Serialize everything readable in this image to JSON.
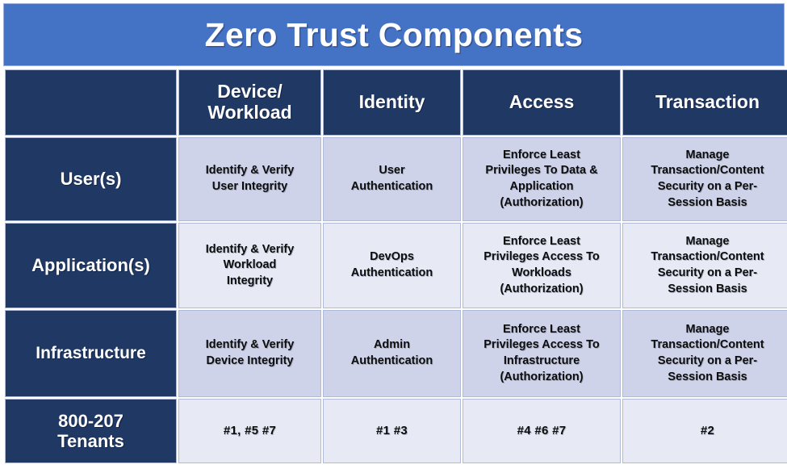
{
  "title": "Zero Trust Components",
  "colors": {
    "title_bg": "#4472C4",
    "header_bg": "#1F3864",
    "band_a": "#CED3E9",
    "band_b": "#E7EAF5",
    "header_text": "#FFFFFF",
    "cell_text": "#0D0D0D"
  },
  "table": {
    "corner_label": "",
    "columns": [
      {
        "label": "Device/\nWorkload"
      },
      {
        "label": "Identity"
      },
      {
        "label": "Access"
      },
      {
        "label": "Transaction"
      }
    ],
    "rows": [
      {
        "label": "User(s)",
        "cells": [
          "Identify & Verify\nUser Integrity",
          "User\nAuthentication",
          "Enforce Least\nPrivileges To Data &\nApplication\n(Authorization)",
          "Manage\nTransaction/Content\nSecurity on a Per-\nSession Basis"
        ]
      },
      {
        "label": "Application(s)",
        "cells": [
          "Identify & Verify\nWorkload\nIntegrity",
          "DevOps\nAuthentication",
          "Enforce Least\nPrivileges Access To\nWorkloads\n(Authorization)",
          "Manage\nTransaction/Content\nSecurity on a Per-\nSession Basis"
        ]
      },
      {
        "label": "Infrastructure",
        "cells": [
          "Identify & Verify\nDevice Integrity",
          "Admin\nAuthentication",
          "Enforce Least\nPrivileges Access To\nInfrastructure\n(Authorization)",
          "Manage\nTransaction/Content\nSecurity on a Per-\nSession Basis"
        ]
      },
      {
        "label": "800-207\nTenants",
        "cells": [
          "#1, #5  #7",
          "#1  #3",
          "#4  #6 #7",
          "#2"
        ]
      }
    ]
  }
}
